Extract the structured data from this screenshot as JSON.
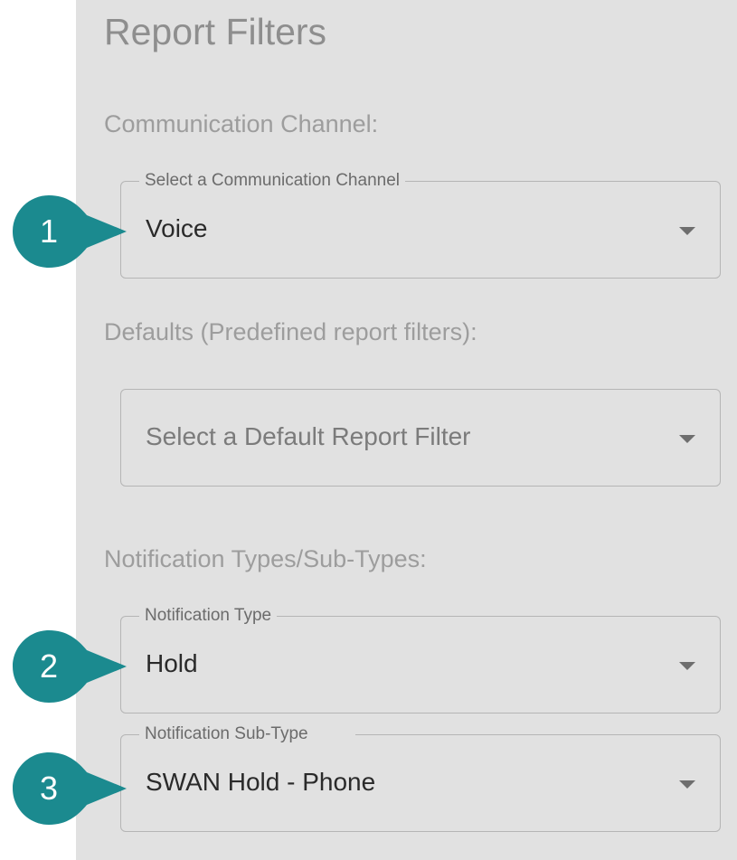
{
  "panel": {
    "title": "Report Filters"
  },
  "sections": {
    "channel_label": "Communication Channel:",
    "defaults_label": "Defaults (Predefined report filters):",
    "notification_label": "Notification Types/Sub-Types:"
  },
  "fields": {
    "channel": {
      "legend": "Select a Communication Channel",
      "value": "Voice"
    },
    "default_filter": {
      "placeholder": "Select a Default Report Filter"
    },
    "notification_type": {
      "legend": "Notification Type",
      "value": "Hold"
    },
    "notification_subtype": {
      "legend": "Notification Sub-Type",
      "value": "SWAN Hold - Phone"
    }
  },
  "callouts": [
    "1",
    "2",
    "3"
  ],
  "colors": {
    "callout": "#1b8a8f",
    "panel_background": "#e1e1e1"
  },
  "icons": {
    "dropdown": "caret-down-icon"
  }
}
